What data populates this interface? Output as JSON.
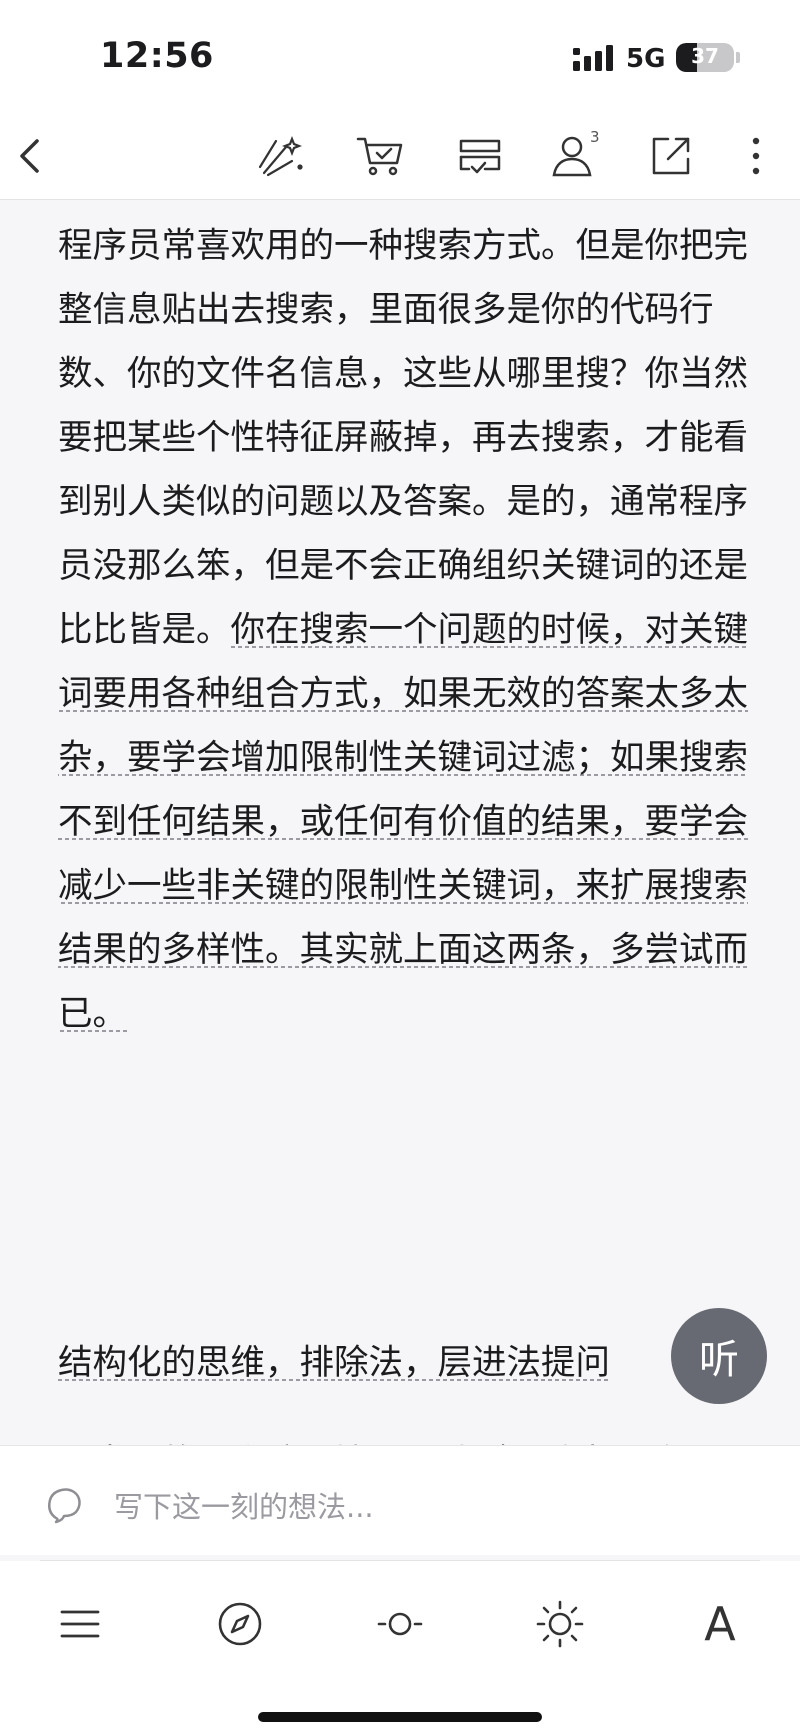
{
  "status_bar": {
    "time": "12:56",
    "network": "5G",
    "battery_level": 37
  },
  "nav": {
    "friend_count": "3",
    "icons": [
      "back-icon",
      "magic-wand-icon",
      "cart-icon",
      "bookshelf-icon",
      "user-icon",
      "share-icon",
      "more-icon"
    ]
  },
  "article": {
    "paragraph_1_plain": "程序员常喜欢用的一种搜索方式。但是你把完整信息贴出去搜索，里面很多是你的代码行数、你的文件名信息，这些从哪里搜？你当然要把某些个性特征屏蔽掉，再去搜索，才能看到别人类似的问题以及答案。是的，通常程序员没那么笨，但是不会正确组织关键词的还是比比皆是。",
    "paragraph_1_underlined": "你在搜索一个问题的时候，对关键词要用各种组合方式，如果无效的答案太多太杂，要学会增加限制性关键词过滤；如果搜索不到任何结果，或任何有价值的结果，要学会减少一些非关键的限制性关键词，来扩展搜索结果的多样性。其实就上面这两条，多尝试而已。",
    "heading": "结构化的思维，排除法，层进法提问",
    "paragraph_3": "我常用的一个培训情景测试（面试中不敢用，因为基本没人可以过关，但培训中常用）是这样的。假设数据库服务器挂了，没反应了，假设我就是个菜鸟运维，"
  },
  "listen_button": {
    "label": "听"
  },
  "comment": {
    "placeholder": "写下这一刻的想法..."
  },
  "toolbar": {
    "icons": [
      "menu-icon",
      "compass-icon",
      "brightness-low-icon",
      "brightness-high-icon",
      "font-icon"
    ],
    "font_label": "A"
  },
  "colors": {
    "background": "#f6f6f8",
    "text": "#1c1c1e",
    "listen_button": "#676a72",
    "placeholder": "#9a9aa0"
  }
}
